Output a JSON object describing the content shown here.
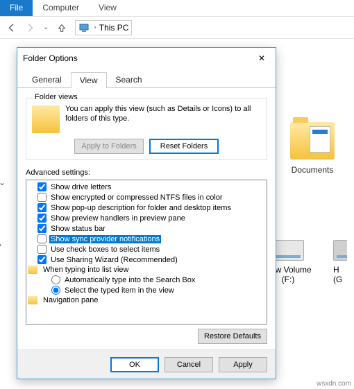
{
  "ribbon": {
    "file": "File",
    "computer": "Computer",
    "view": "View"
  },
  "nav": {
    "location": "This PC"
  },
  "background": {
    "documents": "Documents",
    "drive_f": "New Volume (F:)",
    "drive_g_partial": "H\n(G"
  },
  "dialog": {
    "title": "Folder Options",
    "tabs": {
      "general": "General",
      "view": "View",
      "search": "Search"
    },
    "folder_views": {
      "legend": "Folder views",
      "desc": "You can apply this view (such as Details or Icons) to all folders of this type.",
      "apply": "Apply to Folders",
      "reset": "Reset Folders"
    },
    "advanced_label": "Advanced settings:",
    "settings": [
      {
        "label": "Show drive letters",
        "checked": true,
        "type": "check"
      },
      {
        "label": "Show encrypted or compressed NTFS files in color",
        "checked": false,
        "type": "check"
      },
      {
        "label": "Show pop-up description for folder and desktop items",
        "checked": true,
        "type": "check"
      },
      {
        "label": "Show preview handlers in preview pane",
        "checked": true,
        "type": "check"
      },
      {
        "label": "Show status bar",
        "checked": true,
        "type": "check"
      },
      {
        "label": "Show sync provider notifications",
        "checked": false,
        "type": "check",
        "selected": true
      },
      {
        "label": "Use check boxes to select items",
        "checked": false,
        "type": "check"
      },
      {
        "label": "Use Sharing Wizard (Recommended)",
        "checked": true,
        "type": "check"
      },
      {
        "label": "When typing into list view",
        "type": "folder"
      },
      {
        "label": "Automatically type into the Search Box",
        "type": "radio",
        "checked": false,
        "indent": true
      },
      {
        "label": "Select the typed item in the view",
        "type": "radio",
        "checked": true,
        "indent": true
      },
      {
        "label": "Navigation pane",
        "type": "folder"
      }
    ],
    "restore": "Restore Defaults",
    "footer": {
      "ok": "OK",
      "cancel": "Cancel",
      "apply": "Apply"
    }
  },
  "watermark": "wsxdn.com"
}
